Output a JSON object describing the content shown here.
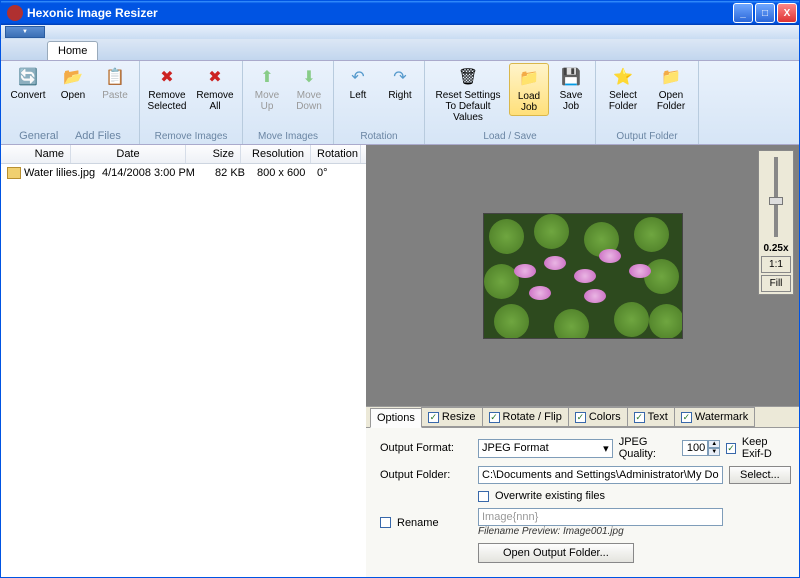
{
  "window_title": "Hexonic Image Resizer",
  "home_tab": "Home",
  "ribbon": {
    "general": {
      "label": "General",
      "convert": "Convert",
      "open": "Open",
      "paste": "Paste"
    },
    "addfiles": {
      "label": "Add Files"
    },
    "remove": {
      "label": "Remove Images",
      "selected": "Remove Selected",
      "all": "Remove All"
    },
    "move": {
      "label": "Move Images",
      "up": "Move Up",
      "down": "Move Down"
    },
    "rotation": {
      "label": "Rotation",
      "left": "Left",
      "right": "Right"
    },
    "loadsave": {
      "label": "Load / Save",
      "reset": "Reset Settings To Default Values",
      "load": "Load Job",
      "save": "Save Job"
    },
    "outfolder": {
      "label": "Output Folder",
      "select": "Select Folder",
      "open": "Open Folder"
    }
  },
  "columns": {
    "name": "Name",
    "date": "Date",
    "size": "Size",
    "res": "Resolution",
    "rot": "Rotation"
  },
  "files": [
    {
      "name": "Water lilies.jpg",
      "date": "4/14/2008 3:00 PM",
      "size": "82 KB",
      "res": "800 x 600",
      "rot": "0°"
    }
  ],
  "zoom": {
    "level": "0.25x",
    "oneToOne": "1:1",
    "fill": "Fill"
  },
  "btabs": {
    "options": "Options",
    "resize": "Resize",
    "rotate": "Rotate / Flip",
    "colors": "Colors",
    "text": "Text",
    "watermark": "Watermark"
  },
  "opts": {
    "output_format_label": "Output Format:",
    "output_format_value": "JPEG Format",
    "jpeg_quality_label": "JPEG Quality:",
    "jpeg_quality_value": "100",
    "keep_exif_label": "Keep Exif-D",
    "output_folder_label": "Output Folder:",
    "output_folder_value": "C:\\Documents and Settings\\Administrator\\My Docum",
    "select_btn": "Select...",
    "overwrite_label": "Overwrite existing files",
    "rename_label": "Rename",
    "rename_placeholder": "Image{nnn}",
    "filename_preview": "Filename Preview: Image001.jpg",
    "open_output_btn": "Open Output Folder..."
  }
}
